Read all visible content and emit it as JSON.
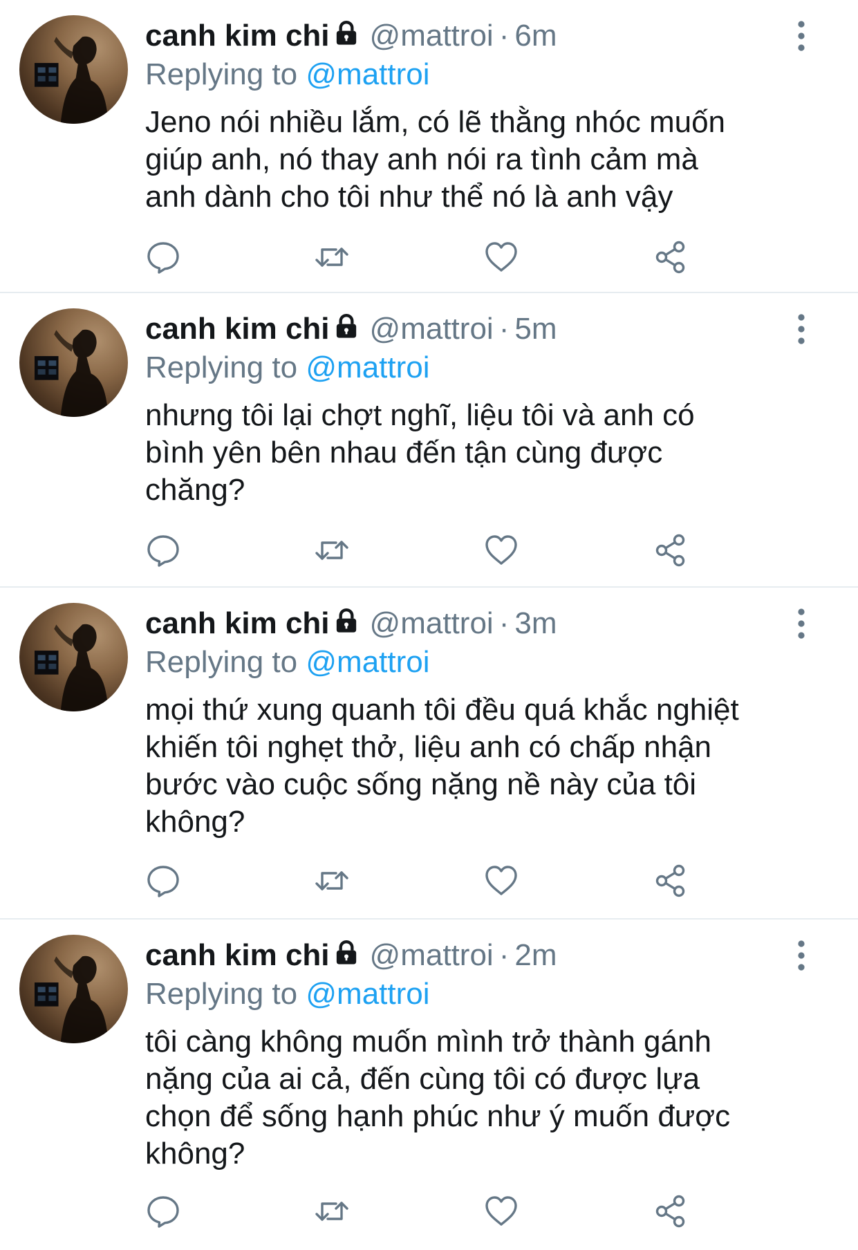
{
  "tweets": [
    {
      "name": "canh kim chi",
      "handle": "@mattroi",
      "separator": "·",
      "time": "6m",
      "reply_prefix": "Replying to",
      "reply_to": "@mattroi",
      "text": "Jeno nói nhiều lắm, có lẽ thằng nhóc muốn\ngiúp anh, nó thay anh nói ra tình cảm mà\nanh dành cho tôi như thể nó là anh vậy"
    },
    {
      "name": "canh kim chi",
      "handle": "@mattroi",
      "separator": "·",
      "time": "5m",
      "reply_prefix": "Replying to",
      "reply_to": "@mattroi",
      "text": "nhưng tôi lại chợt nghĩ, liệu tôi và anh có\nbình yên bên nhau đến tận cùng được\nchăng?"
    },
    {
      "name": "canh kim chi",
      "handle": "@mattroi",
      "separator": "·",
      "time": "3m",
      "reply_prefix": "Replying to",
      "reply_to": "@mattroi",
      "text": "mọi thứ xung quanh tôi đều quá khắc nghiệt\nkhiến tôi nghẹt thở, liệu anh có chấp nhận\nbước vào cuộc sống nặng nề này của tôi\nkhông?"
    },
    {
      "name": "canh kim chi",
      "handle": "@mattroi",
      "separator": "·",
      "time": "2m",
      "reply_prefix": "Replying to",
      "reply_to": "@mattroi",
      "text": "tôi càng không muốn mình trở thành gánh\nnặng của ai cả, đến cùng tôi có được lựa\nchọn để sống hạnh phúc như ý muốn được\nkhông?"
    }
  ],
  "icons": {
    "lock": "lock-icon",
    "more": "more-vertical-icon",
    "reply": "reply-icon",
    "retweet": "retweet-icon",
    "like": "heart-icon",
    "share": "share-icon"
  },
  "colors": {
    "text": "#14171a",
    "secondary": "#657786",
    "link": "#1da1f2",
    "divider": "#e6ecf0"
  }
}
